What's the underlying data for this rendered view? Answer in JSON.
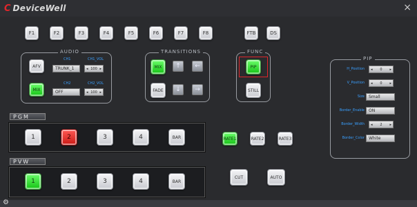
{
  "app": {
    "logo": "DeviceWell",
    "close": "×"
  },
  "function_keys": [
    "F1",
    "F2",
    "F3",
    "F4",
    "F5",
    "F6",
    "F7",
    "F8"
  ],
  "extra_keys": [
    "FTB",
    "DS"
  ],
  "audio": {
    "title": "AUDIO",
    "afv": "AFV",
    "mix": "MIX",
    "ch1": "CH1",
    "ch1_vol": "CH1_VOL",
    "ch2": "CH2",
    "ch2_vol": "CH2_VOL",
    "ch1_value": "TRUNK_1",
    "ch2_value": "OFF",
    "ch1_vol_value": "100",
    "ch2_vol_value": "100"
  },
  "transitions": {
    "title": "TRANSITIONS",
    "mix": "MIX",
    "fade": "FADE"
  },
  "func": {
    "title": "FUNC",
    "pip": "PIP",
    "still": "STILL"
  },
  "pip": {
    "title": "PIP",
    "rows": [
      {
        "label": "H_Position",
        "value": "0"
      },
      {
        "label": "V_Position",
        "value": "0"
      },
      {
        "label": "Size",
        "value": "Small"
      },
      {
        "label": "Border_Enable",
        "value": "ON"
      },
      {
        "label": "Border_Width",
        "value": "2"
      },
      {
        "label": "Border_Color",
        "value": "White"
      }
    ]
  },
  "pgm": {
    "title": "PGM",
    "buttons": [
      "1",
      "2",
      "3",
      "4",
      "BAR"
    ],
    "active": "2"
  },
  "pvw": {
    "title": "PVW",
    "buttons": [
      "1",
      "2",
      "3",
      "4",
      "BAR"
    ],
    "active": "1"
  },
  "rates": [
    "RATE1",
    "RATE2",
    "RATE3"
  ],
  "cut": "CUT",
  "auto": "AUTO",
  "colors": {
    "green": "#22dd22",
    "red": "#e02020",
    "accent_blue": "#3aa0ff"
  }
}
